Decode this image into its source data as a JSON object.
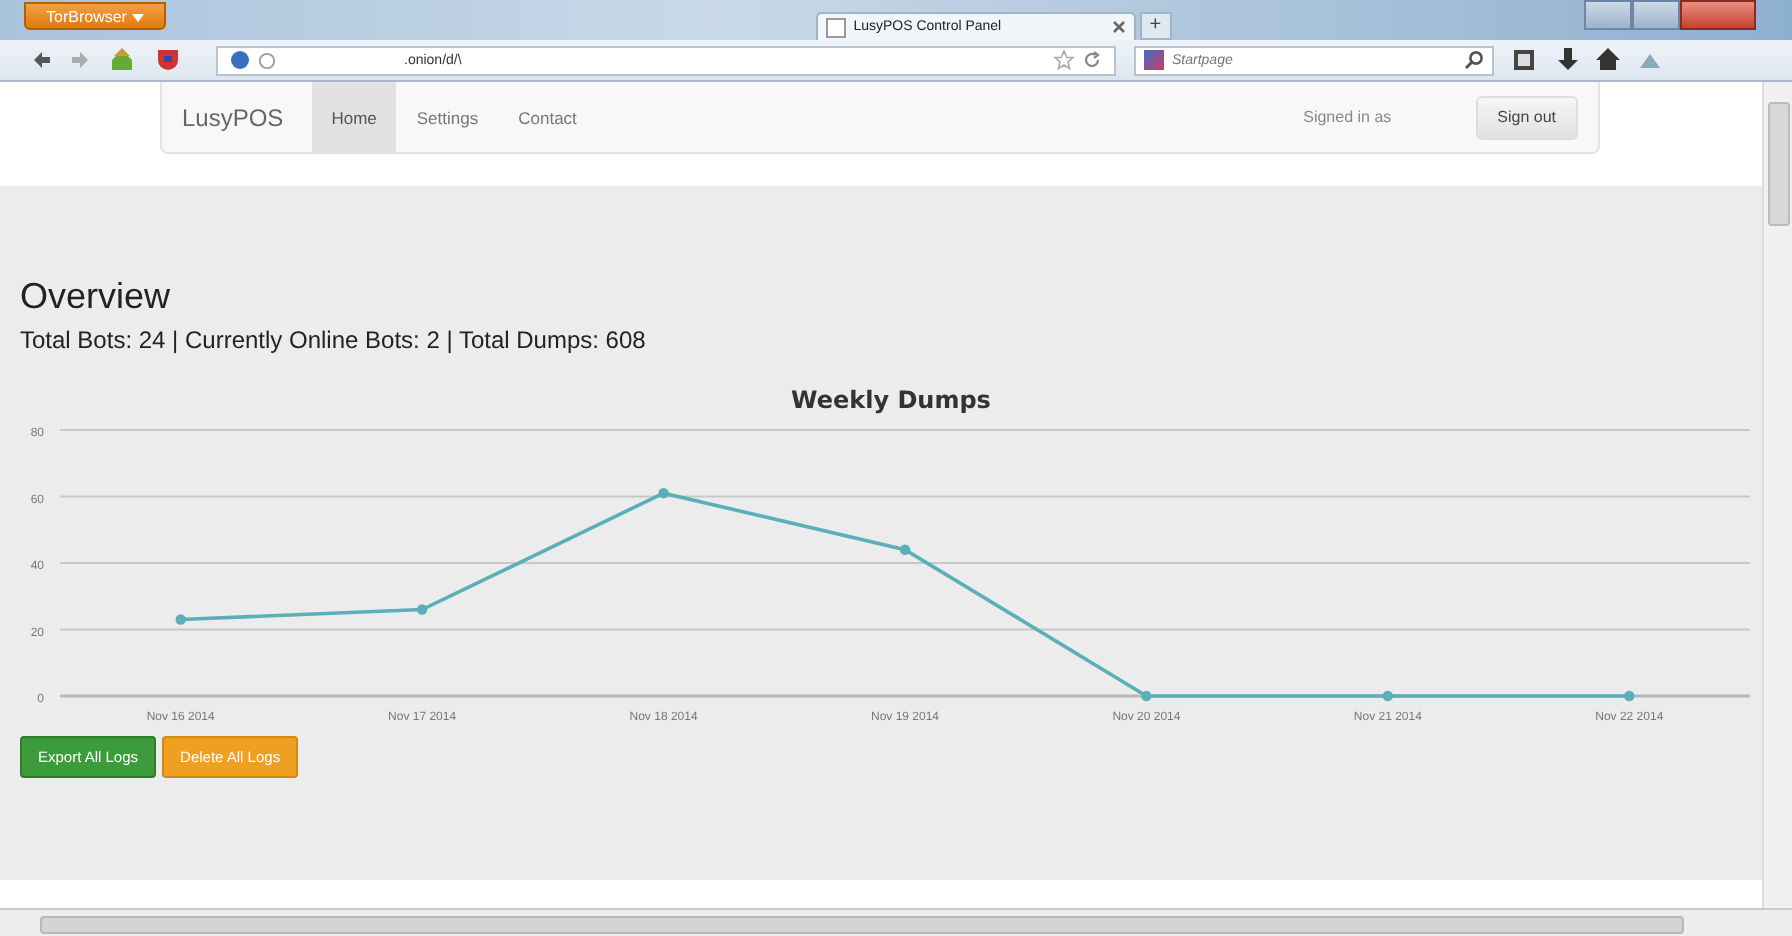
{
  "browser": {
    "menu_button": "TorBrowser",
    "tabs": [
      {
        "title": "LusyPOS Control Panel",
        "selected": true
      }
    ],
    "new_tab": "+",
    "url": ".onion/d/\\",
    "search": {
      "placeholder": "Startpage"
    }
  },
  "navbar": {
    "brand": "LusyPOS",
    "items": [
      {
        "label": "Home",
        "selected": true
      },
      {
        "label": "Settings",
        "selected": false
      },
      {
        "label": "Contact",
        "selected": false
      }
    ],
    "signed_in": "Signed in as",
    "sign_out": "Sign out"
  },
  "heading": "Overview",
  "stats": "Total Bots: 24 | Currently Online Bots: 2 | Total Dumps: 608",
  "chart_data": {
    "type": "line",
    "title": "Weekly Dumps",
    "categories": [
      "Nov 16 2014",
      "Nov 17 2014",
      "Nov 18 2014",
      "Nov 19 2014",
      "Nov 20 2014",
      "Nov 21 2014",
      "Nov 22 2014"
    ],
    "series": [
      {
        "color": "#5aafb8",
        "marker": "circle",
        "values": [
          23,
          26,
          61,
          44,
          0,
          0,
          0
        ]
      }
    ],
    "ylim": [
      0,
      80
    ],
    "yticks": [
      0,
      20,
      40,
      60,
      80
    ],
    "grid": true
  },
  "buttons": [
    {
      "label": "Export All Logs",
      "kind": "success"
    },
    {
      "label": "Delete All Logs",
      "kind": "warning"
    }
  ]
}
